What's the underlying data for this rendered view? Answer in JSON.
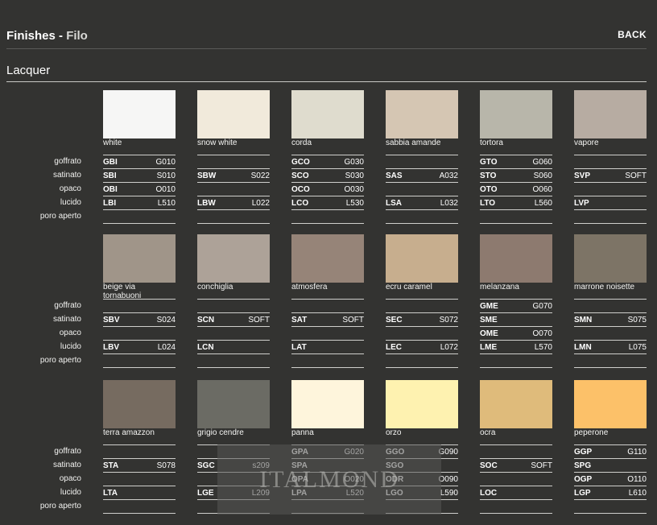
{
  "header": {
    "title": "Finishes - ",
    "subtitle": "Filo",
    "back_label": "BACK"
  },
  "section": {
    "title": "Lacquer"
  },
  "finish_labels": [
    "goffrato",
    "satinato",
    "opaco",
    "lucido",
    "poro aperto"
  ],
  "watermark": "ITALMOND",
  "rows": [
    {
      "colors": [
        {
          "name": "white",
          "swatch": "#f6f6f5",
          "finishes": [
            [
              "GBI",
              "G010"
            ],
            [
              "SBI",
              "S010"
            ],
            [
              "OBI",
              "O010"
            ],
            [
              "LBI",
              "L510"
            ],
            [
              "",
              ""
            ]
          ]
        },
        {
          "name": "snow white",
          "swatch": "#f1eadb",
          "finishes": [
            [
              "",
              ""
            ],
            [
              "SBW",
              "S022"
            ],
            [
              "",
              ""
            ],
            [
              "LBW",
              "L022"
            ],
            [
              "",
              ""
            ]
          ]
        },
        {
          "name": "corda",
          "swatch": "#dfdcce",
          "finishes": [
            [
              "GCO",
              "G030"
            ],
            [
              "SCO",
              "S030"
            ],
            [
              "OCO",
              "O030"
            ],
            [
              "LCO",
              "L530"
            ],
            [
              "",
              ""
            ]
          ]
        },
        {
          "name": "sabbia amande",
          "swatch": "#d5c6b3",
          "finishes": [
            [
              "",
              ""
            ],
            [
              "SAS",
              "A032"
            ],
            [
              "",
              ""
            ],
            [
              "LSA",
              "L032"
            ],
            [
              "",
              ""
            ]
          ]
        },
        {
          "name": "tortora",
          "swatch": "#b8b6aa",
          "finishes": [
            [
              "GTO",
              "G060"
            ],
            [
              "STO",
              "S060"
            ],
            [
              "OTO",
              "O060"
            ],
            [
              "LTO",
              "L560"
            ],
            [
              "",
              ""
            ]
          ]
        },
        {
          "name": "vapore",
          "swatch": "#b7aca2",
          "finishes": [
            [
              "",
              ""
            ],
            [
              "SVP",
              "SOFT"
            ],
            [
              "",
              ""
            ],
            [
              "LVP",
              ""
            ],
            [
              "",
              ""
            ]
          ]
        }
      ]
    },
    {
      "colors": [
        {
          "name": "beige via tornabuoni",
          "swatch": "#a09589",
          "finishes": [
            [
              "",
              ""
            ],
            [
              "SBV",
              "S024"
            ],
            [
              "",
              ""
            ],
            [
              "LBV",
              "L024"
            ],
            [
              "",
              ""
            ]
          ]
        },
        {
          "name": "conchiglia",
          "swatch": "#ada298",
          "finishes": [
            [
              "",
              ""
            ],
            [
              "SCN",
              "SOFT"
            ],
            [
              "",
              ""
            ],
            [
              "LCN",
              ""
            ],
            [
              "",
              ""
            ]
          ]
        },
        {
          "name": "atmosfera",
          "swatch": "#968478",
          "finishes": [
            [
              "",
              ""
            ],
            [
              "SAT",
              "SOFT"
            ],
            [
              "",
              ""
            ],
            [
              "LAT",
              ""
            ],
            [
              "",
              ""
            ]
          ]
        },
        {
          "name": "ecru caramel",
          "swatch": "#c7ae8e",
          "finishes": [
            [
              "",
              ""
            ],
            [
              "SEC",
              "S072"
            ],
            [
              "",
              ""
            ],
            [
              "LEC",
              "L072"
            ],
            [
              "",
              ""
            ]
          ]
        },
        {
          "name": "melanzana",
          "swatch": "#8d7a6f",
          "finishes": [
            [
              "GME",
              "G070"
            ],
            [
              "SME",
              ""
            ],
            [
              "OME",
              "O070"
            ],
            [
              "LME",
              "L570"
            ],
            [
              "",
              ""
            ]
          ]
        },
        {
          "name": "marrone noisette",
          "swatch": "#7d7466",
          "finishes": [
            [
              "",
              ""
            ],
            [
              "SMN",
              "S075"
            ],
            [
              "",
              ""
            ],
            [
              "LMN",
              "L075"
            ],
            [
              "",
              ""
            ]
          ]
        }
      ]
    },
    {
      "colors": [
        {
          "name": "terra amazzon",
          "swatch": "#766b60",
          "finishes": [
            [
              "",
              ""
            ],
            [
              "STA",
              "S078"
            ],
            [
              "",
              ""
            ],
            [
              "LTA",
              ""
            ],
            [
              "",
              ""
            ]
          ]
        },
        {
          "name": "grigio cendre",
          "swatch": "#6b6b64",
          "finishes": [
            [
              "",
              ""
            ],
            [
              "SGC",
              "s209"
            ],
            [
              "",
              ""
            ],
            [
              "LGE",
              "L209"
            ],
            [
              "",
              ""
            ]
          ]
        },
        {
          "name": "panna",
          "swatch": "#fef5dc",
          "finishes": [
            [
              "GPA",
              "G020"
            ],
            [
              "SPA",
              ""
            ],
            [
              "OPA",
              "O020"
            ],
            [
              "LPA",
              "L520"
            ],
            [
              "",
              ""
            ]
          ]
        },
        {
          "name": "orzo",
          "swatch": "#fef2b0",
          "finishes": [
            [
              "GGO",
              "G090"
            ],
            [
              "SGO",
              ""
            ],
            [
              "ODR",
              "O090"
            ],
            [
              "LGO",
              "L590"
            ],
            [
              "",
              ""
            ]
          ]
        },
        {
          "name": "ocra",
          "swatch": "#dfbb7b",
          "finishes": [
            [
              "",
              ""
            ],
            [
              "SOC",
              "SOFT"
            ],
            [
              "",
              ""
            ],
            [
              "LOC",
              ""
            ],
            [
              "",
              ""
            ]
          ]
        },
        {
          "name": "peperone",
          "swatch": "#fcc169",
          "finishes": [
            [
              "GGP",
              "G110"
            ],
            [
              "SPG",
              ""
            ],
            [
              "OGP",
              "O110"
            ],
            [
              "LGP",
              "L610"
            ],
            [
              "",
              ""
            ]
          ]
        }
      ]
    }
  ]
}
